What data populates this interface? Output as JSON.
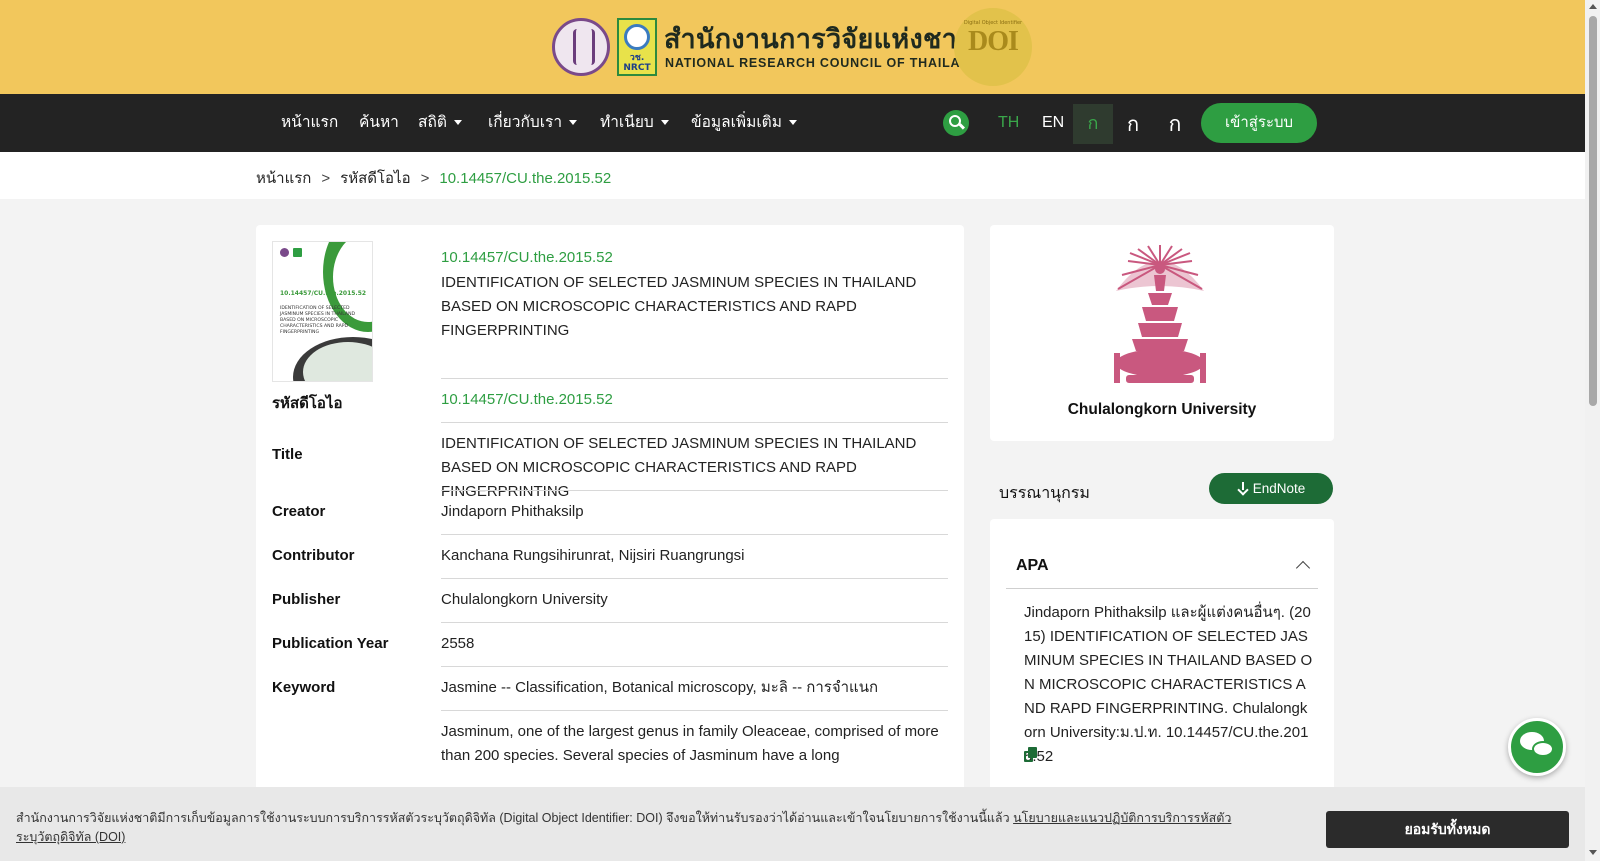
{
  "header": {
    "org_name_th": "สำนักงานการวิจัยแห่งชาติ",
    "org_name_en": "NATIONAL RESEARCH COUNCIL OF THAILAND",
    "nrct_logo_text": "วช. NRCT",
    "doi_badge_text": "DOI",
    "doi_badge_caption": "Digital Object Identifier"
  },
  "nav": {
    "items": [
      {
        "label": "หน้าแรก"
      },
      {
        "label": "ค้นหา"
      },
      {
        "label": "สถิติ"
      },
      {
        "label": "เกี่ยวกับเรา"
      },
      {
        "label": "ทำเนียบ"
      },
      {
        "label": "ข้อมูลเพิ่มเติม"
      }
    ],
    "lang_th": "TH",
    "lang_en": "EN",
    "font_sizes": [
      "ก",
      "ก",
      "ก"
    ],
    "login_label": "เข้าสู่ระบบ"
  },
  "breadcrumb": {
    "home": "หน้าแรก",
    "section": "รหัสดีโอไอ",
    "current": "10.14457/CU.the.2015.52",
    "separator": ">"
  },
  "record": {
    "cover": {
      "doi": "10.14457/CU.the.2015.52",
      "title": "IDENTIFICATION OF SELECTED JASMINUM SPECIES IN THAILAND BASED ON MICROSCOPIC CHARACTERISTICS AND RAPD FINGERPRINTING"
    },
    "doi": "10.14457/CU.the.2015.52",
    "title": "IDENTIFICATION OF SELECTED JASMINUM SPECIES IN THAILAND BASED ON MICROSCOPIC CHARACTERISTICS AND RAPD FINGERPRINTING",
    "fields": {
      "doi": {
        "label": "รหัสดีโอไอ",
        "value": "10.14457/CU.the.2015.52"
      },
      "title": {
        "label": "Title",
        "value": "IDENTIFICATION OF SELECTED JASMINUM SPECIES IN THAILAND BASED ON MICROSCOPIC CHARACTERISTICS AND RAPD FINGERPRINTING"
      },
      "creator": {
        "label": "Creator",
        "value": "Jindaporn Phithaksilp"
      },
      "contributor": {
        "label": "Contributor",
        "value": "Kanchana Rungsihirunrat, Nijsiri Ruangrungsi"
      },
      "publisher": {
        "label": "Publisher",
        "value": "Chulalongkorn University"
      },
      "year": {
        "label": "Publication Year",
        "value": "2558"
      },
      "keyword": {
        "label": "Keyword",
        "value": "Jasmine -- Classification, Botanical microscopy, มะลิ -- การจำแนก"
      },
      "abstract": {
        "value": "Jasminum, one of the largest genus in family Oleaceae, comprised of more than 200 species. Several species of Jasminum have a long"
      }
    }
  },
  "sidebar": {
    "university_name": "Chulalongkorn University",
    "bibliography_label": "บรรณานุกรม",
    "endnote_label": "EndNote",
    "apa_label": "APA",
    "apa_citation": "Jindaporn Phithaksilp และผู้แต่งคนอื่นๆ. (2015) IDENTIFICATION OF SELECTED JASMINUM SPECIES IN THAILAND BASED ON MICROSCOPIC CHARACTERISTICS AND RAPD FINGERPRINTING. Chulalongkorn University:ม.ป.ท. 10.14457/CU.the.2015.52"
  },
  "cookie": {
    "text": "สำนักงานการวิจัยแห่งชาติมีการเก็บข้อมูลการใช้งานระบบการบริการรหัสตัวระบุวัตถุดิจิทัล (Digital Object Identifier: DOI) จึงขอให้ท่านรับรองว่าได้อ่านและเข้าใจนโยบายการใช้งานนี้แล้ว",
    "link": "นโยบายและแนวปฏิบัติการบริการรหัสตัวระบุวัตถุดิจิทัล (DOI)",
    "accept_label": "ยอมรับทั้งหมด"
  },
  "colors": {
    "banner": "#f2c75c",
    "navbar": "#232323",
    "accent_green": "#2e9e42",
    "dark_green": "#1d6b36",
    "crest_pink": "#c9587f"
  },
  "icons": [
    "search-icon",
    "download-icon",
    "chevron-up-icon",
    "copy-icon",
    "chat-icon"
  ]
}
